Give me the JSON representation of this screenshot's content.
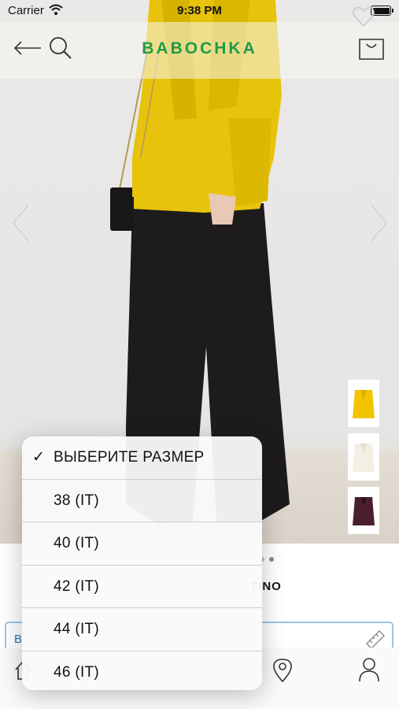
{
  "status": {
    "carrier": "Carrier",
    "time": "9:38 PM"
  },
  "header": {
    "logo": "BABOCHKA"
  },
  "icons": {
    "back": "arrow-left-icon",
    "search": "search-icon",
    "cart": "shopping-bag-icon",
    "wishlist": "heart-icon",
    "ruler": "ruler-icon",
    "location": "map-pin-icon",
    "profile": "person-icon"
  },
  "colors": {
    "brand": "#1f9b4a",
    "swatches": [
      "#f2c400",
      "#f3efe2",
      "#4a1f2b"
    ]
  },
  "product": {
    "brand_partial": "TINO"
  },
  "size_field": {
    "text_partial": "В"
  },
  "size_menu": {
    "items": [
      {
        "label": "ВЫБЕРИТЕ РАЗМЕР",
        "checked": true
      },
      {
        "label": "38 (IT)",
        "checked": false
      },
      {
        "label": "40 (IT)",
        "checked": false
      },
      {
        "label": "42 (IT)",
        "checked": false
      },
      {
        "label": "44 (IT)",
        "checked": false
      },
      {
        "label": "46 (IT)",
        "checked": false
      }
    ],
    "checkmark": "✓"
  }
}
